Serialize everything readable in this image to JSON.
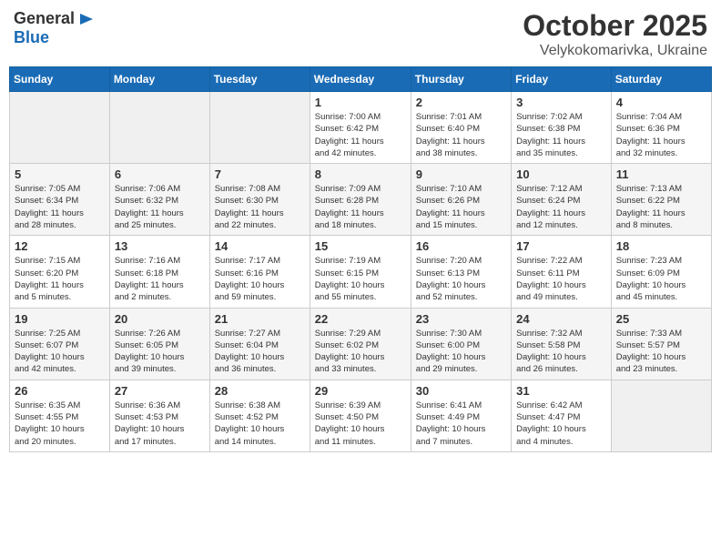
{
  "header": {
    "logo_general": "General",
    "logo_blue": "Blue",
    "month_year": "October 2025",
    "location": "Velykokomarivka, Ukraine"
  },
  "weekdays": [
    "Sunday",
    "Monday",
    "Tuesday",
    "Wednesday",
    "Thursday",
    "Friday",
    "Saturday"
  ],
  "weeks": [
    [
      {
        "day": "",
        "info": ""
      },
      {
        "day": "",
        "info": ""
      },
      {
        "day": "",
        "info": ""
      },
      {
        "day": "1",
        "info": "Sunrise: 7:00 AM\nSunset: 6:42 PM\nDaylight: 11 hours\nand 42 minutes."
      },
      {
        "day": "2",
        "info": "Sunrise: 7:01 AM\nSunset: 6:40 PM\nDaylight: 11 hours\nand 38 minutes."
      },
      {
        "day": "3",
        "info": "Sunrise: 7:02 AM\nSunset: 6:38 PM\nDaylight: 11 hours\nand 35 minutes."
      },
      {
        "day": "4",
        "info": "Sunrise: 7:04 AM\nSunset: 6:36 PM\nDaylight: 11 hours\nand 32 minutes."
      }
    ],
    [
      {
        "day": "5",
        "info": "Sunrise: 7:05 AM\nSunset: 6:34 PM\nDaylight: 11 hours\nand 28 minutes."
      },
      {
        "day": "6",
        "info": "Sunrise: 7:06 AM\nSunset: 6:32 PM\nDaylight: 11 hours\nand 25 minutes."
      },
      {
        "day": "7",
        "info": "Sunrise: 7:08 AM\nSunset: 6:30 PM\nDaylight: 11 hours\nand 22 minutes."
      },
      {
        "day": "8",
        "info": "Sunrise: 7:09 AM\nSunset: 6:28 PM\nDaylight: 11 hours\nand 18 minutes."
      },
      {
        "day": "9",
        "info": "Sunrise: 7:10 AM\nSunset: 6:26 PM\nDaylight: 11 hours\nand 15 minutes."
      },
      {
        "day": "10",
        "info": "Sunrise: 7:12 AM\nSunset: 6:24 PM\nDaylight: 11 hours\nand 12 minutes."
      },
      {
        "day": "11",
        "info": "Sunrise: 7:13 AM\nSunset: 6:22 PM\nDaylight: 11 hours\nand 8 minutes."
      }
    ],
    [
      {
        "day": "12",
        "info": "Sunrise: 7:15 AM\nSunset: 6:20 PM\nDaylight: 11 hours\nand 5 minutes."
      },
      {
        "day": "13",
        "info": "Sunrise: 7:16 AM\nSunset: 6:18 PM\nDaylight: 11 hours\nand 2 minutes."
      },
      {
        "day": "14",
        "info": "Sunrise: 7:17 AM\nSunset: 6:16 PM\nDaylight: 10 hours\nand 59 minutes."
      },
      {
        "day": "15",
        "info": "Sunrise: 7:19 AM\nSunset: 6:15 PM\nDaylight: 10 hours\nand 55 minutes."
      },
      {
        "day": "16",
        "info": "Sunrise: 7:20 AM\nSunset: 6:13 PM\nDaylight: 10 hours\nand 52 minutes."
      },
      {
        "day": "17",
        "info": "Sunrise: 7:22 AM\nSunset: 6:11 PM\nDaylight: 10 hours\nand 49 minutes."
      },
      {
        "day": "18",
        "info": "Sunrise: 7:23 AM\nSunset: 6:09 PM\nDaylight: 10 hours\nand 45 minutes."
      }
    ],
    [
      {
        "day": "19",
        "info": "Sunrise: 7:25 AM\nSunset: 6:07 PM\nDaylight: 10 hours\nand 42 minutes."
      },
      {
        "day": "20",
        "info": "Sunrise: 7:26 AM\nSunset: 6:05 PM\nDaylight: 10 hours\nand 39 minutes."
      },
      {
        "day": "21",
        "info": "Sunrise: 7:27 AM\nSunset: 6:04 PM\nDaylight: 10 hours\nand 36 minutes."
      },
      {
        "day": "22",
        "info": "Sunrise: 7:29 AM\nSunset: 6:02 PM\nDaylight: 10 hours\nand 33 minutes."
      },
      {
        "day": "23",
        "info": "Sunrise: 7:30 AM\nSunset: 6:00 PM\nDaylight: 10 hours\nand 29 minutes."
      },
      {
        "day": "24",
        "info": "Sunrise: 7:32 AM\nSunset: 5:58 PM\nDaylight: 10 hours\nand 26 minutes."
      },
      {
        "day": "25",
        "info": "Sunrise: 7:33 AM\nSunset: 5:57 PM\nDaylight: 10 hours\nand 23 minutes."
      }
    ],
    [
      {
        "day": "26",
        "info": "Sunrise: 6:35 AM\nSunset: 4:55 PM\nDaylight: 10 hours\nand 20 minutes."
      },
      {
        "day": "27",
        "info": "Sunrise: 6:36 AM\nSunset: 4:53 PM\nDaylight: 10 hours\nand 17 minutes."
      },
      {
        "day": "28",
        "info": "Sunrise: 6:38 AM\nSunset: 4:52 PM\nDaylight: 10 hours\nand 14 minutes."
      },
      {
        "day": "29",
        "info": "Sunrise: 6:39 AM\nSunset: 4:50 PM\nDaylight: 10 hours\nand 11 minutes."
      },
      {
        "day": "30",
        "info": "Sunrise: 6:41 AM\nSunset: 4:49 PM\nDaylight: 10 hours\nand 7 minutes."
      },
      {
        "day": "31",
        "info": "Sunrise: 6:42 AM\nSunset: 4:47 PM\nDaylight: 10 hours\nand 4 minutes."
      },
      {
        "day": "",
        "info": ""
      }
    ]
  ]
}
